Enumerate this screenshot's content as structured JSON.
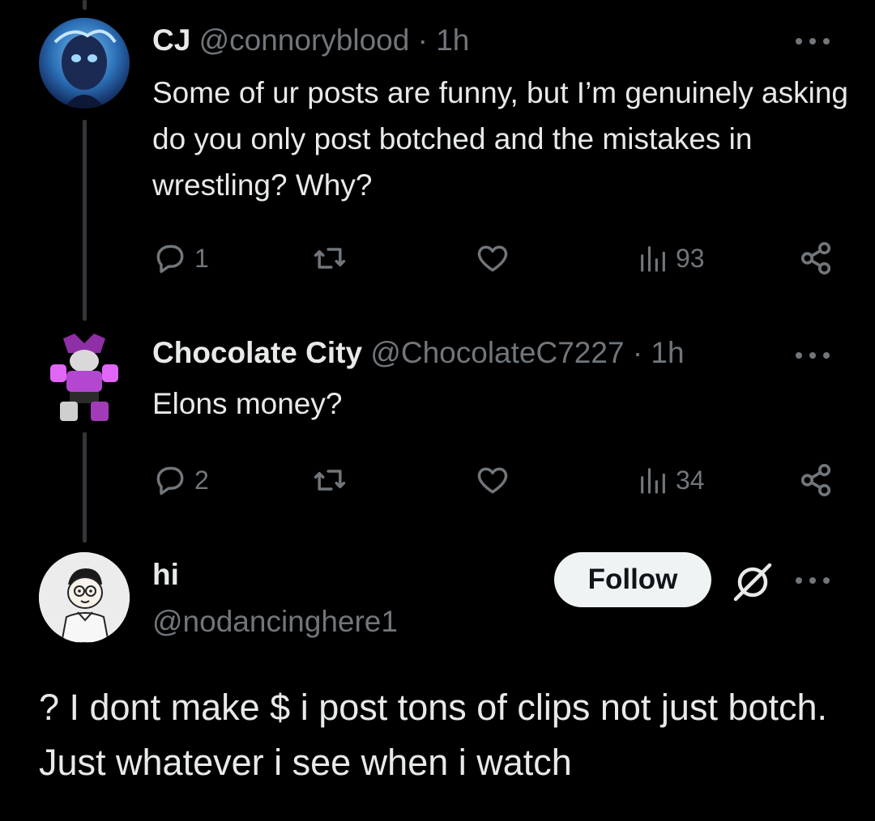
{
  "posts": [
    {
      "display_name": "CJ",
      "handle": "@connoryblood",
      "separator": "·",
      "time": "1h",
      "text": "Some of ur posts are funny, but I’m genuinely asking do you only post botched and the mistakes in wrestling? Why?",
      "replies": "1",
      "reposts": "",
      "likes": "",
      "views": "93",
      "avatar_colors": [
        "#1d3a78",
        "#4a9fd8"
      ]
    },
    {
      "display_name": "Chocolate City",
      "handle": "@ChocolateC7227",
      "separator": "·",
      "time": "1h",
      "text": "Elons money?",
      "replies": "2",
      "reposts": "",
      "likes": "",
      "views": "34",
      "avatar_colors": [
        "#a23bb8",
        "#e066f5"
      ]
    }
  ],
  "author": {
    "display_name": "hi",
    "handle": "@nodancinghere1",
    "follow_label": "Follow",
    "text": "? I dont make $ i post tons of clips not just botch. Just whatever i see when i watch"
  },
  "colors": {
    "background": "#000000",
    "text": "#e7e9ea",
    "secondary": "#71767b",
    "thread_line": "#333639",
    "follow_bg": "#eff3f4"
  },
  "icons": [
    "reply-icon",
    "repost-icon",
    "like-icon",
    "views-icon",
    "share-icon",
    "more-icon",
    "grok-icon"
  ]
}
